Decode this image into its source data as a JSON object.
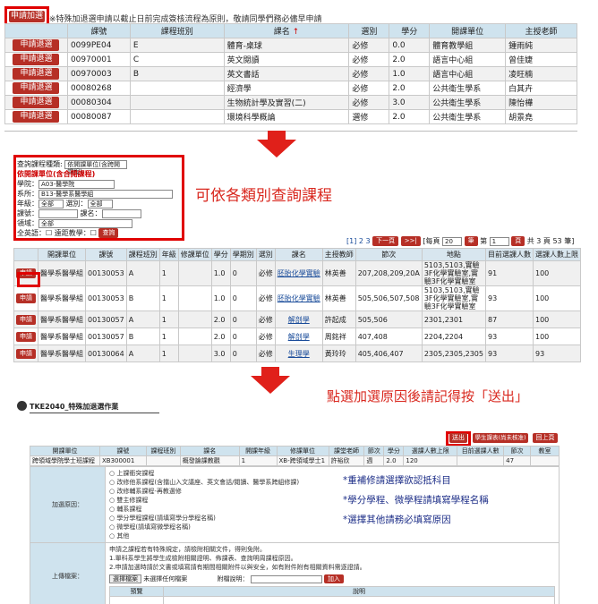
{
  "panel1": {
    "add_button": "申請加選",
    "note": "※特殊加退選申請以截止日前完成簽核流程為原則，敬請同學們務必儘早申請",
    "columns": [
      "課號",
      "課程班別",
      "課名",
      "選別",
      "學分",
      "開課單位",
      "主授老師"
    ],
    "sort_marker": "↑",
    "row_button": "申請退選",
    "rows": [
      [
        "0099PE04",
        "E",
        "體育-桌球",
        "必修",
        "0.0",
        "體育教學組",
        "鍾雨純"
      ],
      [
        "00970001",
        "C",
        "英文閱讀",
        "必修",
        "2.0",
        "語言中心組",
        "曾佳婕"
      ],
      [
        "00970003",
        "B",
        "英文書話",
        "必修",
        "1.0",
        "語言中心組",
        "凌旺楠"
      ],
      [
        "00080268",
        "",
        "經濟學",
        "必修",
        "2.0",
        "公共衛生學系",
        "白其卉"
      ],
      [
        "00080304",
        "",
        "生物統計學及實習(二)",
        "必修",
        "3.0",
        "公共衛生學系",
        "陳怡樺"
      ],
      [
        "00080087",
        "",
        "環境科學概論",
        "選修",
        "2.0",
        "公共衛生學系",
        "胡景堯"
      ]
    ]
  },
  "panel2": {
    "hint": "可依各類別查詢課程",
    "form": {
      "kind_label": "查詢課程種類:",
      "kind_value": "依開課單位(含跨開課程)",
      "section_title": "依開課單位(含合開課程)",
      "college_label": "學院：",
      "college_value": "A03-醫學院",
      "dept_label": "系所：",
      "dept_value": "B13-醫學系醫學組",
      "year_label": "年級：",
      "year_value": "全部",
      "type_label": "選別：",
      "type_value": "全部",
      "code_label": "課號：",
      "name_label": "課名：",
      "field_label": "領域：",
      "field_value": "全部",
      "english_label": "全英語：",
      "remote_label": "遠距教學：",
      "query_button": "查詢"
    },
    "pager": {
      "pages": "[1] 2 3",
      "first": "下一頁",
      "last": ">>|",
      "per_page_label": "[每頁",
      "per_page_value": "20",
      "per_page_unit": "筆",
      "page_label": "第",
      "page_value": "1",
      "page_unit": "頁",
      "summary": "共 3 頁 53 筆]"
    },
    "columns": [
      "",
      "開課單位",
      "課號",
      "課程班別",
      "年級",
      "修課單位",
      "學分",
      "學期別",
      "選別",
      "課名",
      "主授教師",
      "節次",
      "地點",
      "目前選課人數",
      "選課人數上限"
    ],
    "row_button": "申請",
    "rows": [
      [
        "醫學系醫學組",
        "00130053",
        "A",
        "1",
        "",
        "1.0",
        "0",
        "必修",
        "胚胎化學實驗",
        "林英善",
        "207,208,209,20A",
        "5103,5103,實驗3F化學實驗室,實驗3F化學實驗室",
        "91",
        "100"
      ],
      [
        "醫學系醫學組",
        "00130053",
        "B",
        "1",
        "",
        "1.0",
        "0",
        "必修",
        "胚胎化學實驗",
        "林英善",
        "505,506,507,508",
        "5103,5103,實驗3F化學實驗室,實驗3F化學實驗室",
        "93",
        "100"
      ],
      [
        "醫學系醫學組",
        "00130057",
        "A",
        "1",
        "",
        "2.0",
        "0",
        "必修",
        "解剖學",
        "許起成",
        "505,506",
        "2301,2301",
        "87",
        "100"
      ],
      [
        "醫學系醫學組",
        "00130057",
        "B",
        "1",
        "",
        "2.0",
        "0",
        "必修",
        "解剖學",
        "周銘祥",
        "407,408",
        "2204,2204",
        "93",
        "100"
      ],
      [
        "醫學系醫學組",
        "00130064",
        "A",
        "1",
        "",
        "3.0",
        "0",
        "必修",
        "生理學",
        "黃玲玲",
        "405,406,407",
        "2305,2305,2305",
        "93",
        "93"
      ]
    ]
  },
  "panel3": {
    "hint": "點選加選原因後請記得按「送出」",
    "page_title": "TKE2040_特殊加退選作業",
    "submit_button": "送出",
    "schedule_button": "學生課表(尚未核准)",
    "back_button": "回上頁",
    "columns": [
      "開課單位",
      "課號",
      "課程班別",
      "課名",
      "開課年級",
      "修課單位",
      "課堂老師",
      "節次",
      "學分",
      "選課人數上限",
      "目前選課人數",
      "節次",
      "教室"
    ],
    "row": [
      "跨領域學院學士班課程",
      "XB300001",
      "",
      "概發論課教觀",
      "1",
      "XB-跨領域學士1",
      "許裕欣",
      "週",
      "2.0",
      "120",
      "",
      "47",
      ""
    ],
    "reason_label": "加選原因：",
    "reasons": [
      "上課衝突課程",
      "改修他系課程(含擋山入文議座、英文會話/閱讀、醫學系跨組修課)",
      "改修輔系課程-再教選修",
      "雙主修課程",
      "輔系課程",
      "學分學程課程(請填寫學分學程名稱)",
      "微學程(請填寫微學程名稱)",
      "其他"
    ],
    "notes": [
      "*重補修請選擇欲認抵科目",
      "*學分學程、微學程請填寫學程名稱",
      "*選擇其他請務必填寫原因"
    ],
    "upload_label": "上傳檔案：",
    "upload_help_1": "申請之課程若有特殊規定，請檢附相關文件，得則免附。",
    "upload_help_2": "1.單科系學生將學生成檢附相關證明、佈課表、查詢明周課程原因。",
    "upload_help_3": "2.申請加選時請於文書或填寫請有期間相關附件以與安全，如有附件附有相關資料需逐證請。",
    "choose_file_button": "選擇檔案",
    "no_file": "未選擇任何檔案",
    "desc_label": "附檔說明：",
    "add_button": "加入",
    "file_columns": [
      "預覽",
      "說明"
    ]
  }
}
